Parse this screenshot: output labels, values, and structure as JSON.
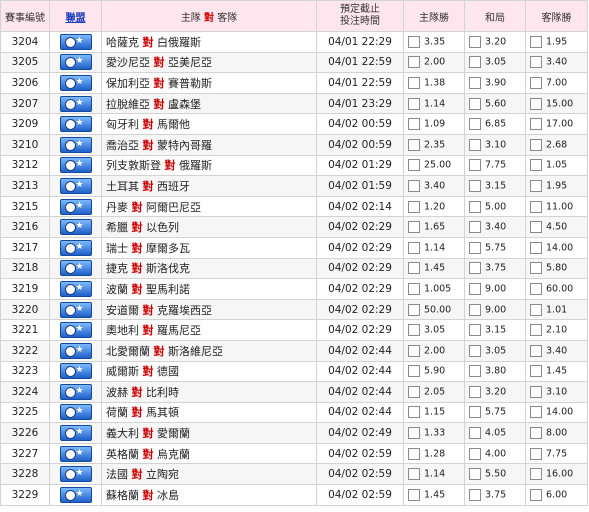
{
  "header": {
    "match_id": "賽事編號",
    "league": "聯盟",
    "match_home": "主隊",
    "match_vs": "對",
    "match_away": "客隊",
    "deadline_line1": "預定截止",
    "deadline_line2": "投注時間",
    "home_win": "主隊勝",
    "draw": "和局",
    "away_win": "客隊勝"
  },
  "rows": [
    {
      "id": "3204",
      "home": "哈薩克",
      "vs": "對",
      "away": "白俄羅斯",
      "time": "04/01 22:29",
      "home_odds": "3.35",
      "draw_odds": "3.20",
      "away_odds": "1.95"
    },
    {
      "id": "3205",
      "home": "愛沙尼亞",
      "vs": "對",
      "away": "亞美尼亞",
      "time": "04/01 22:59",
      "home_odds": "2.00",
      "draw_odds": "3.05",
      "away_odds": "3.40"
    },
    {
      "id": "3206",
      "home": "保加利亞",
      "vs": "對",
      "away": "賽普勒斯",
      "time": "04/01 22:59",
      "home_odds": "1.38",
      "draw_odds": "3.90",
      "away_odds": "7.00"
    },
    {
      "id": "3207",
      "home": "拉脫維亞",
      "vs": "對",
      "away": "盧森堡",
      "time": "04/01 23:29",
      "home_odds": "1.14",
      "draw_odds": "5.60",
      "away_odds": "15.00"
    },
    {
      "id": "3209",
      "home": "匈牙利",
      "vs": "對",
      "away": "馬爾他",
      "time": "04/02 00:59",
      "home_odds": "1.09",
      "draw_odds": "6.85",
      "away_odds": "17.00"
    },
    {
      "id": "3210",
      "home": "喬治亞",
      "vs": "對",
      "away": "蒙特內哥羅",
      "time": "04/02 00:59",
      "home_odds": "2.35",
      "draw_odds": "3.10",
      "away_odds": "2.68"
    },
    {
      "id": "3212",
      "home": "列支敦斯登",
      "vs": "對",
      "away": "俄羅斯",
      "time": "04/02 01:29",
      "home_odds": "25.00",
      "draw_odds": "7.75",
      "away_odds": "1.05"
    },
    {
      "id": "3213",
      "home": "土耳其",
      "vs": "對",
      "away": "西班牙",
      "time": "04/02 01:59",
      "home_odds": "3.40",
      "draw_odds": "3.15",
      "away_odds": "1.95"
    },
    {
      "id": "3215",
      "home": "丹麥",
      "vs": "對",
      "away": "阿爾巴尼亞",
      "time": "04/02 02:14",
      "home_odds": "1.20",
      "draw_odds": "5.00",
      "away_odds": "11.00"
    },
    {
      "id": "3216",
      "home": "希臘",
      "vs": "對",
      "away": "以色列",
      "time": "04/02 02:29",
      "home_odds": "1.65",
      "draw_odds": "3.40",
      "away_odds": "4.50"
    },
    {
      "id": "3217",
      "home": "瑞士",
      "vs": "對",
      "away": "摩爾多瓦",
      "time": "04/02 02:29",
      "home_odds": "1.14",
      "draw_odds": "5.75",
      "away_odds": "14.00"
    },
    {
      "id": "3218",
      "home": "捷克",
      "vs": "對",
      "away": "斯洛伐克",
      "time": "04/02 02:29",
      "home_odds": "1.45",
      "draw_odds": "3.75",
      "away_odds": "5.80"
    },
    {
      "id": "3219",
      "home": "波蘭",
      "vs": "對",
      "away": "聖馬利諾",
      "time": "04/02 02:29",
      "home_odds": "1.005",
      "draw_odds": "9.00",
      "away_odds": "60.00"
    },
    {
      "id": "3220",
      "home": "安道爾",
      "vs": "對",
      "away": "克羅埃西亞",
      "time": "04/02 02:29",
      "home_odds": "50.00",
      "draw_odds": "9.00",
      "away_odds": "1.01"
    },
    {
      "id": "3221",
      "home": "奧地利",
      "vs": "對",
      "away": "羅馬尼亞",
      "time": "04/02 02:29",
      "home_odds": "3.05",
      "draw_odds": "3.15",
      "away_odds": "2.10"
    },
    {
      "id": "3222",
      "home": "北愛爾蘭",
      "vs": "對",
      "away": "斯洛維尼亞",
      "time": "04/02 02:44",
      "home_odds": "2.00",
      "draw_odds": "3.05",
      "away_odds": "3.40"
    },
    {
      "id": "3223",
      "home": "威爾斯",
      "vs": "對",
      "away": "德國",
      "time": "04/02 02:44",
      "home_odds": "5.90",
      "draw_odds": "3.80",
      "away_odds": "1.45"
    },
    {
      "id": "3224",
      "home": "波赫",
      "vs": "對",
      "away": "比利時",
      "time": "04/02 02:44",
      "home_odds": "2.05",
      "draw_odds": "3.20",
      "away_odds": "3.10"
    },
    {
      "id": "3225",
      "home": "荷蘭",
      "vs": "對",
      "away": "馬其頓",
      "time": "04/02 02:44",
      "home_odds": "1.15",
      "draw_odds": "5.75",
      "away_odds": "14.00"
    },
    {
      "id": "3226",
      "home": "義大利",
      "vs": "對",
      "away": "愛爾蘭",
      "time": "04/02 02:49",
      "home_odds": "1.33",
      "draw_odds": "4.05",
      "away_odds": "8.00"
    },
    {
      "id": "3227",
      "home": "英格蘭",
      "vs": "對",
      "away": "烏克蘭",
      "time": "04/02 02:59",
      "home_odds": "1.28",
      "draw_odds": "4.00",
      "away_odds": "7.75"
    },
    {
      "id": "3228",
      "home": "法國",
      "vs": "對",
      "away": "立陶宛",
      "time": "04/02 02:59",
      "home_odds": "1.14",
      "draw_odds": "5.50",
      "away_odds": "16.00"
    },
    {
      "id": "3229",
      "home": "蘇格蘭",
      "vs": "對",
      "away": "冰島",
      "time": "04/02 02:59",
      "home_odds": "1.45",
      "draw_odds": "3.75",
      "away_odds": "6.00"
    }
  ],
  "league_icon": "world-cup-qualifier-badge-icon",
  "colors": {
    "header_bg": "#ffe6ee",
    "vs": "#cc0000",
    "league_header": "#1a3bc0"
  }
}
